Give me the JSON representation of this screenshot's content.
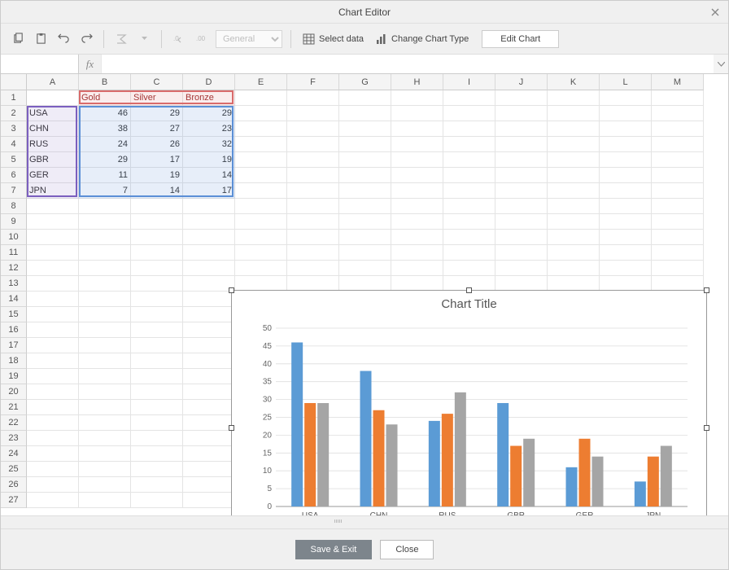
{
  "window": {
    "title": "Chart Editor"
  },
  "toolbar": {
    "format_value": "General",
    "select_data": "Select data",
    "change_type": "Change Chart Type",
    "edit_chart": "Edit Chart"
  },
  "formulabar": {
    "namebox": "",
    "fx": "fx",
    "formula": ""
  },
  "sheet": {
    "columns": [
      "A",
      "B",
      "C",
      "D",
      "E",
      "F",
      "G",
      "H",
      "I",
      "J",
      "K",
      "L",
      "M"
    ],
    "rows": 27,
    "headers": {
      "B1": "Gold",
      "C1": "Silver",
      "D1": "Bronze"
    },
    "countries": [
      "USA",
      "CHN",
      "RUS",
      "GBR",
      "GER",
      "JPN"
    ]
  },
  "chart_data": {
    "type": "bar",
    "title": "Chart Title",
    "xlabel": "",
    "ylabel": "",
    "ylim": [
      0,
      50
    ],
    "ytick_step": 5,
    "categories": [
      "USA",
      "CHN",
      "RUS",
      "GBR",
      "GER",
      "JPN"
    ],
    "series": [
      {
        "name": "Gold",
        "color": "#5b9bd5",
        "values": [
          46,
          38,
          24,
          29,
          11,
          7
        ]
      },
      {
        "name": "Silver",
        "color": "#ed7d31",
        "values": [
          29,
          27,
          26,
          17,
          19,
          14
        ]
      },
      {
        "name": "Bronze",
        "color": "#a5a5a5",
        "values": [
          29,
          23,
          32,
          19,
          14,
          17
        ]
      }
    ]
  },
  "footer": {
    "save": "Save & Exit",
    "close": "Close"
  }
}
